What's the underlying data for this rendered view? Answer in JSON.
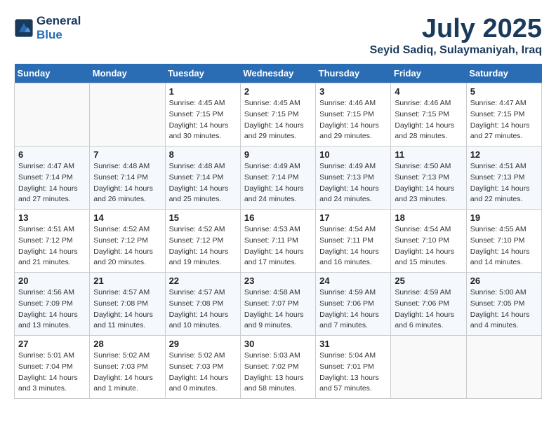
{
  "header": {
    "logo_line1": "General",
    "logo_line2": "Blue",
    "month": "July 2025",
    "location": "Seyid Sadiq, Sulaymaniyah, Iraq"
  },
  "weekdays": [
    "Sunday",
    "Monday",
    "Tuesday",
    "Wednesday",
    "Thursday",
    "Friday",
    "Saturday"
  ],
  "weeks": [
    [
      {
        "day": "",
        "info": ""
      },
      {
        "day": "",
        "info": ""
      },
      {
        "day": "1",
        "info": "Sunrise: 4:45 AM\nSunset: 7:15 PM\nDaylight: 14 hours and 30 minutes."
      },
      {
        "day": "2",
        "info": "Sunrise: 4:45 AM\nSunset: 7:15 PM\nDaylight: 14 hours and 29 minutes."
      },
      {
        "day": "3",
        "info": "Sunrise: 4:46 AM\nSunset: 7:15 PM\nDaylight: 14 hours and 29 minutes."
      },
      {
        "day": "4",
        "info": "Sunrise: 4:46 AM\nSunset: 7:15 PM\nDaylight: 14 hours and 28 minutes."
      },
      {
        "day": "5",
        "info": "Sunrise: 4:47 AM\nSunset: 7:15 PM\nDaylight: 14 hours and 27 minutes."
      }
    ],
    [
      {
        "day": "6",
        "info": "Sunrise: 4:47 AM\nSunset: 7:14 PM\nDaylight: 14 hours and 27 minutes."
      },
      {
        "day": "7",
        "info": "Sunrise: 4:48 AM\nSunset: 7:14 PM\nDaylight: 14 hours and 26 minutes."
      },
      {
        "day": "8",
        "info": "Sunrise: 4:48 AM\nSunset: 7:14 PM\nDaylight: 14 hours and 25 minutes."
      },
      {
        "day": "9",
        "info": "Sunrise: 4:49 AM\nSunset: 7:14 PM\nDaylight: 14 hours and 24 minutes."
      },
      {
        "day": "10",
        "info": "Sunrise: 4:49 AM\nSunset: 7:13 PM\nDaylight: 14 hours and 24 minutes."
      },
      {
        "day": "11",
        "info": "Sunrise: 4:50 AM\nSunset: 7:13 PM\nDaylight: 14 hours and 23 minutes."
      },
      {
        "day": "12",
        "info": "Sunrise: 4:51 AM\nSunset: 7:13 PM\nDaylight: 14 hours and 22 minutes."
      }
    ],
    [
      {
        "day": "13",
        "info": "Sunrise: 4:51 AM\nSunset: 7:12 PM\nDaylight: 14 hours and 21 minutes."
      },
      {
        "day": "14",
        "info": "Sunrise: 4:52 AM\nSunset: 7:12 PM\nDaylight: 14 hours and 20 minutes."
      },
      {
        "day": "15",
        "info": "Sunrise: 4:52 AM\nSunset: 7:12 PM\nDaylight: 14 hours and 19 minutes."
      },
      {
        "day": "16",
        "info": "Sunrise: 4:53 AM\nSunset: 7:11 PM\nDaylight: 14 hours and 17 minutes."
      },
      {
        "day": "17",
        "info": "Sunrise: 4:54 AM\nSunset: 7:11 PM\nDaylight: 14 hours and 16 minutes."
      },
      {
        "day": "18",
        "info": "Sunrise: 4:54 AM\nSunset: 7:10 PM\nDaylight: 14 hours and 15 minutes."
      },
      {
        "day": "19",
        "info": "Sunrise: 4:55 AM\nSunset: 7:10 PM\nDaylight: 14 hours and 14 minutes."
      }
    ],
    [
      {
        "day": "20",
        "info": "Sunrise: 4:56 AM\nSunset: 7:09 PM\nDaylight: 14 hours and 13 minutes."
      },
      {
        "day": "21",
        "info": "Sunrise: 4:57 AM\nSunset: 7:08 PM\nDaylight: 14 hours and 11 minutes."
      },
      {
        "day": "22",
        "info": "Sunrise: 4:57 AM\nSunset: 7:08 PM\nDaylight: 14 hours and 10 minutes."
      },
      {
        "day": "23",
        "info": "Sunrise: 4:58 AM\nSunset: 7:07 PM\nDaylight: 14 hours and 9 minutes."
      },
      {
        "day": "24",
        "info": "Sunrise: 4:59 AM\nSunset: 7:06 PM\nDaylight: 14 hours and 7 minutes."
      },
      {
        "day": "25",
        "info": "Sunrise: 4:59 AM\nSunset: 7:06 PM\nDaylight: 14 hours and 6 minutes."
      },
      {
        "day": "26",
        "info": "Sunrise: 5:00 AM\nSunset: 7:05 PM\nDaylight: 14 hours and 4 minutes."
      }
    ],
    [
      {
        "day": "27",
        "info": "Sunrise: 5:01 AM\nSunset: 7:04 PM\nDaylight: 14 hours and 3 minutes."
      },
      {
        "day": "28",
        "info": "Sunrise: 5:02 AM\nSunset: 7:03 PM\nDaylight: 14 hours and 1 minute."
      },
      {
        "day": "29",
        "info": "Sunrise: 5:02 AM\nSunset: 7:03 PM\nDaylight: 14 hours and 0 minutes."
      },
      {
        "day": "30",
        "info": "Sunrise: 5:03 AM\nSunset: 7:02 PM\nDaylight: 13 hours and 58 minutes."
      },
      {
        "day": "31",
        "info": "Sunrise: 5:04 AM\nSunset: 7:01 PM\nDaylight: 13 hours and 57 minutes."
      },
      {
        "day": "",
        "info": ""
      },
      {
        "day": "",
        "info": ""
      }
    ]
  ]
}
